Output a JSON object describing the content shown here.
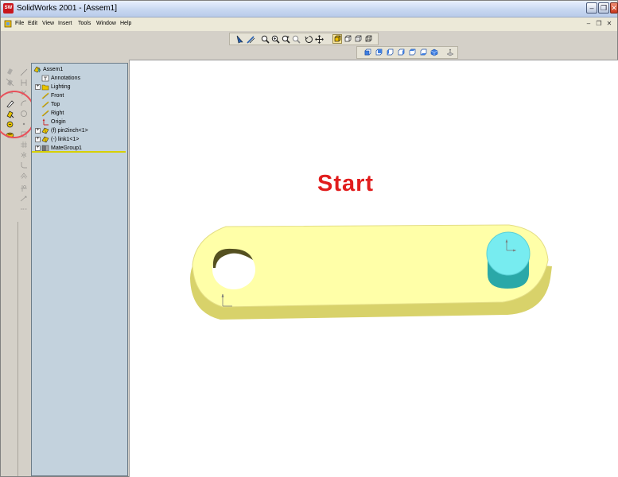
{
  "window": {
    "title": "SolidWorks 2001 - [Assem1]"
  },
  "menu": {
    "items": [
      "File",
      "Edit",
      "View",
      "Insert",
      "Tools",
      "Window",
      "Help"
    ]
  },
  "viewport": {
    "annotation": "Start"
  },
  "tree": {
    "root": "Assem1",
    "items": [
      {
        "label": "Annotations",
        "expand": false,
        "icon": "annotations-icon"
      },
      {
        "label": "Lighting",
        "expand": true,
        "icon": "lighting-folder-icon"
      },
      {
        "label": "Front",
        "expand": false,
        "icon": "plane-icon"
      },
      {
        "label": "Top",
        "expand": false,
        "icon": "plane-icon"
      },
      {
        "label": "Right",
        "expand": false,
        "icon": "plane-icon"
      },
      {
        "label": "Origin",
        "expand": false,
        "icon": "origin-icon"
      },
      {
        "label": "(f) pin2inch<1>",
        "expand": true,
        "icon": "part-icon"
      },
      {
        "label": "(-) link1<1>",
        "expand": true,
        "icon": "part-icon"
      },
      {
        "label": "MateGroup1",
        "expand": true,
        "icon": "mategroup-icon"
      }
    ]
  },
  "colors": {
    "link_face": "#ffffa8",
    "link_side": "#d8d26a",
    "pin": "#77ecf0",
    "pin_side": "#2aa8a8",
    "start_text": "#e11d1d"
  },
  "toolbars": {
    "view": [
      "select-icon",
      "sketch-icon",
      "zoom-fit-icon",
      "zoom-area-icon",
      "zoom-in-out-icon",
      "zoom-selection-icon",
      "rotate-icon",
      "pan-icon",
      "shaded-icon",
      "hidden-removed-icon",
      "hidden-gray-icon",
      "wireframe-icon"
    ],
    "standard_views": [
      "front-view-icon",
      "back-view-icon",
      "left-view-icon",
      "right-view-icon",
      "top-view-icon",
      "bottom-view-icon",
      "isometric-view-icon",
      "normal-to-icon"
    ]
  }
}
